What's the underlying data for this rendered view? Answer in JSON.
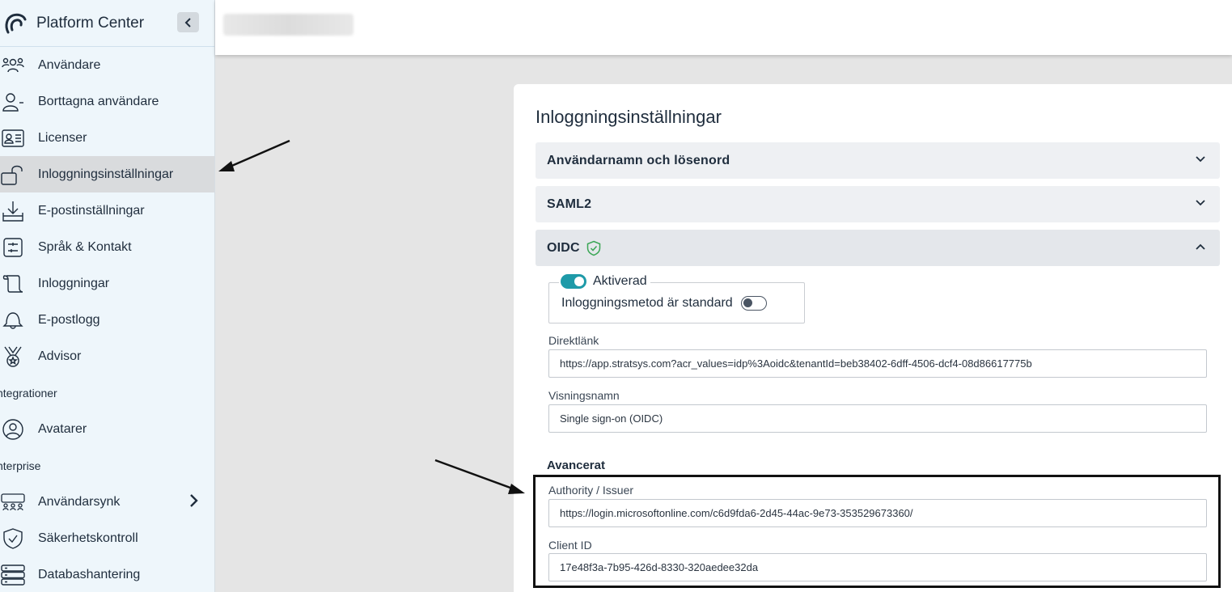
{
  "app": {
    "title": "Platform Center"
  },
  "sidebar": {
    "items": [
      {
        "label": "Användare",
        "icon": "users-icon"
      },
      {
        "label": "Borttagna användare",
        "icon": "user-minus-icon"
      },
      {
        "label": "Licenser",
        "icon": "id-card-icon"
      },
      {
        "label": "Inloggningsinställningar",
        "icon": "unlock-icon",
        "active": true
      },
      {
        "label": "E-postinställningar",
        "icon": "inbox-download-icon"
      },
      {
        "label": "Språk & Kontakt",
        "icon": "sliders-icon"
      },
      {
        "label": "Inloggningar",
        "icon": "scroll-icon"
      },
      {
        "label": "E-postlogg",
        "icon": "bell-icon"
      },
      {
        "label": "Advisor",
        "icon": "medal-icon"
      }
    ],
    "section_integrationer": "ntegrationer",
    "integration_items": [
      {
        "label": "Avatarer",
        "icon": "user-circle-icon"
      }
    ],
    "section_enterprise": "nterprise",
    "enterprise_items": [
      {
        "label": "Användarsynk",
        "icon": "group-sync-icon"
      },
      {
        "label": "Säkerhetskontroll",
        "icon": "shield-check-icon"
      },
      {
        "label": "Databashantering",
        "icon": "database-icon"
      }
    ]
  },
  "main": {
    "title": "Inloggningsinställningar",
    "accordions": [
      {
        "label": "Användarnamn och lösenord",
        "expanded": false
      },
      {
        "label": "SAML2",
        "expanded": false
      },
      {
        "label": "OIDC",
        "expanded": true,
        "verified": true
      }
    ],
    "oidc": {
      "enabled_label": "Aktiverad",
      "enabled": true,
      "default_label": "Inloggningsmetod är standard",
      "default": false,
      "direct_link_label": "Direktlänk",
      "direct_link_value": "https://app.stratsys.com?acr_values=idp%3Aoidc&tenantId=beb38402-6dff-4506-dcf4-08d86617775b",
      "display_name_label": "Visningsnamn",
      "display_name_value": "Single sign-on (OIDC)",
      "advanced_heading": "Avancerat",
      "authority_label": "Authority / Issuer",
      "authority_value": "https://login.microsoftonline.com/c6d9fda6-2d45-44ac-9e73-353529673360/",
      "client_id_label": "Client ID",
      "client_id_value": "17e48f3a-7b95-426d-8330-320aedee32da"
    }
  },
  "colors": {
    "accent": "#1e9aa8",
    "sidebar_bg": "#eef6fb",
    "active_bg": "#d9dbdd",
    "verified": "#3aa655"
  }
}
